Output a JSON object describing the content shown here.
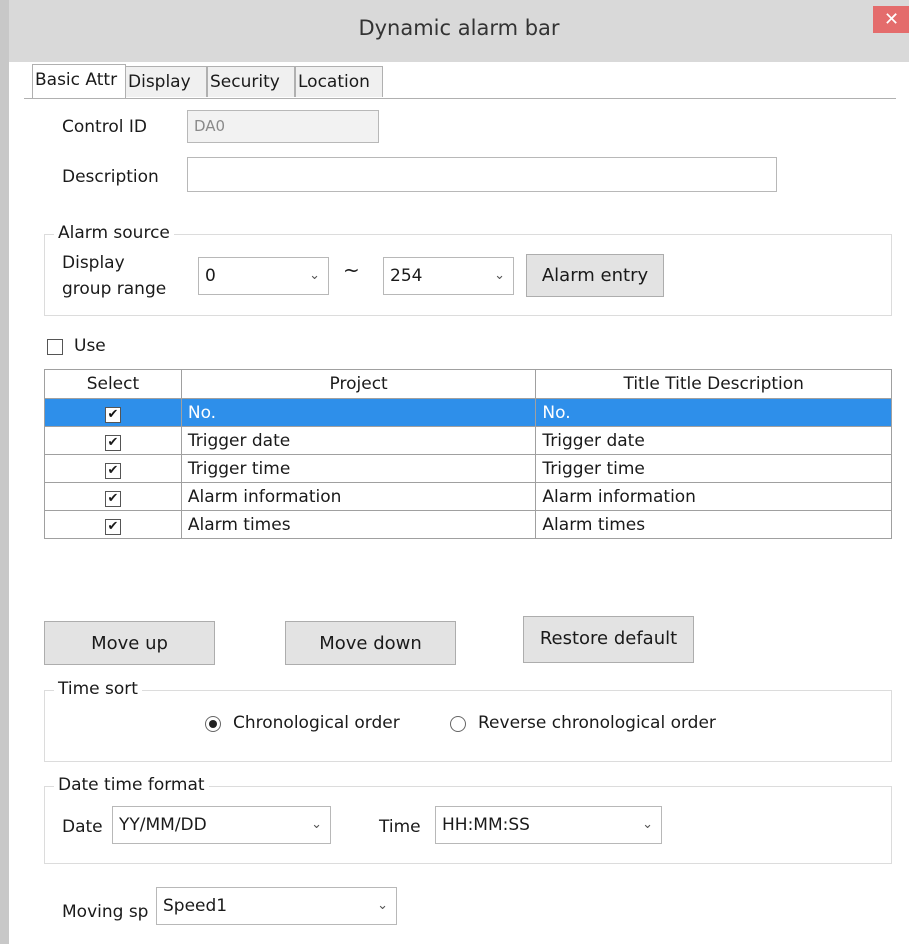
{
  "window": {
    "title": "Dynamic alarm bar"
  },
  "tabs": [
    "Basic Attr",
    "Display",
    "Security",
    "Location"
  ],
  "basic": {
    "control_id_label": "Control ID",
    "control_id_value": "DA0",
    "description_label": "Description",
    "description_value": ""
  },
  "alarm_source": {
    "legend": "Alarm source",
    "range_label_1": "Display",
    "range_label_2": "group range",
    "from_value": "0",
    "tilde": "~",
    "to_value": "254",
    "entry_button": "Alarm entry"
  },
  "use_label": "Use",
  "grid": {
    "headers": [
      "Select",
      "Project",
      "Title  Title Description"
    ],
    "rows": [
      {
        "selected": "✔",
        "project": "No.",
        "title": "No."
      },
      {
        "selected": "✔",
        "project": "Trigger date",
        "title": "Trigger date"
      },
      {
        "selected": "✔",
        "project": "Trigger time",
        "title": "Trigger time"
      },
      {
        "selected": "✔",
        "project": "Alarm information",
        "title": "Alarm information"
      },
      {
        "selected": "✔",
        "project": "Alarm times",
        "title": "Alarm times"
      }
    ],
    "highlight_color": "#2e8fea"
  },
  "buttons": {
    "move_up": "Move up",
    "move_down": "Move down",
    "restore_default": "Restore default"
  },
  "time_sort": {
    "legend": "Time sort",
    "option1": "Chronological order",
    "option2": "Reverse chronological order"
  },
  "datetime": {
    "legend": "Date time format",
    "date_label": "Date",
    "date_value": "YY/MM/DD",
    "time_label": "Time",
    "time_value": "HH:MM:SS"
  },
  "moving": {
    "label": "Moving sp",
    "value": "Speed1"
  },
  "icons": {
    "close": "✕",
    "dropdown": "⌄"
  }
}
